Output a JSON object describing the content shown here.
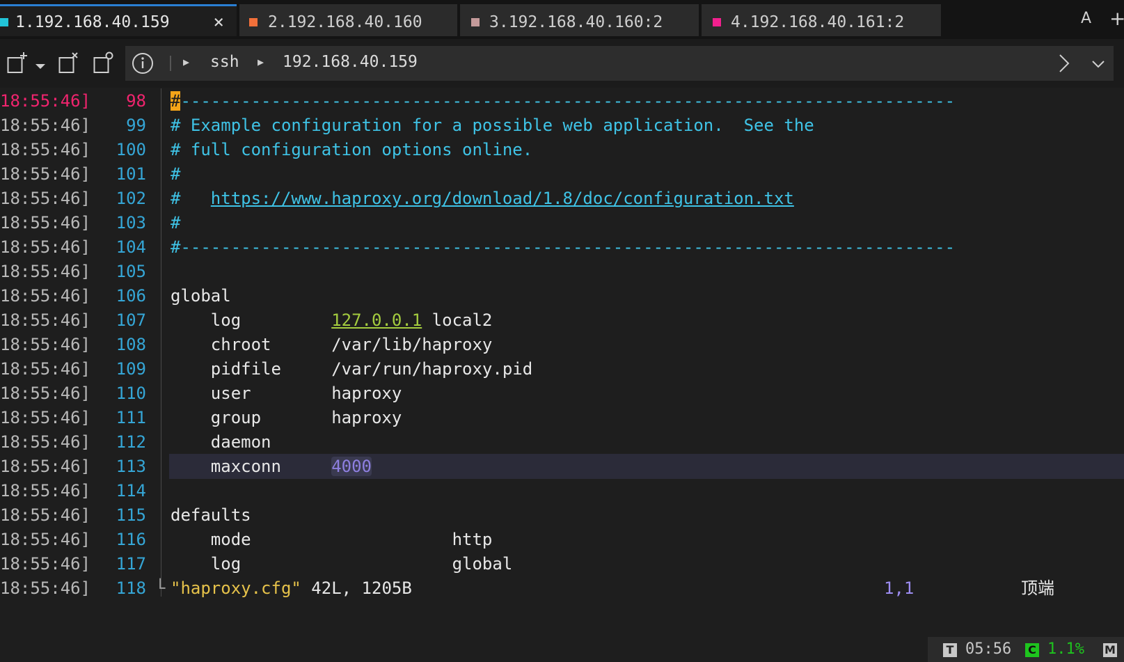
{
  "tabs": [
    {
      "label": "1.192.168.40.159",
      "color": "#22c4d8",
      "active": true
    },
    {
      "label": "2.192.168.40.160",
      "color": "#f2703a",
      "active": false
    },
    {
      "label": "3.192.168.40.160:2",
      "color": "#c49a9a",
      "active": false
    },
    {
      "label": "4.192.168.40.161:2",
      "color": "#f2208e",
      "active": false
    }
  ],
  "tabbar": {
    "close_glyph": "×",
    "font_button": "A",
    "add_tab": "+"
  },
  "toolbar": {
    "icons": [
      "new-tab-icon",
      "dropdown-icon",
      "close-session-icon",
      "session-settings-icon",
      "info-icon",
      "forward-icon",
      "chevron-down-icon"
    ],
    "breadcrumb": [
      "ssh",
      "192.168.40.159"
    ]
  },
  "terminal": {
    "timestamp": "18:55:46]",
    "lines": [
      {
        "n": "98",
        "text": "-----------------------------------------------------------------------------",
        "cursor": "#",
        "kind": "comment"
      },
      {
        "n": "99",
        "text": "# Example configuration for a possible web application.  See the",
        "kind": "comment"
      },
      {
        "n": "100",
        "text": "# full configuration options online.",
        "kind": "comment"
      },
      {
        "n": "101",
        "text": "#",
        "kind": "comment"
      },
      {
        "n": "102",
        "prefix": "#   ",
        "url": "https://www.haproxy.org/download/1.8/doc/configuration.txt",
        "kind": "url"
      },
      {
        "n": "103",
        "text": "#",
        "kind": "comment"
      },
      {
        "n": "104",
        "text": "#-----------------------------------------------------------------------------",
        "kind": "comment"
      },
      {
        "n": "105",
        "text": "",
        "kind": "plain"
      },
      {
        "n": "106",
        "text": "global",
        "kind": "plain"
      },
      {
        "n": "107",
        "key": "    log         ",
        "ip": "127.0.0.1",
        "rest": " local2",
        "kind": "ip"
      },
      {
        "n": "108",
        "text": "    chroot      /var/lib/haproxy",
        "kind": "plain"
      },
      {
        "n": "109",
        "text": "    pidfile     /var/run/haproxy.pid",
        "kind": "plain"
      },
      {
        "n": "110",
        "text": "    user        haproxy",
        "kind": "plain"
      },
      {
        "n": "111",
        "text": "    group       haproxy",
        "kind": "plain"
      },
      {
        "n": "112",
        "text": "    daemon",
        "kind": "plain"
      },
      {
        "n": "113",
        "key": "    maxconn     ",
        "num": "4000",
        "kind": "num",
        "highlight": true
      },
      {
        "n": "114",
        "text": "",
        "kind": "plain"
      },
      {
        "n": "115",
        "text": "defaults",
        "kind": "plain"
      },
      {
        "n": "116",
        "text": "    mode                    http",
        "kind": "plain"
      },
      {
        "n": "117",
        "text": "    log                     global",
        "kind": "plain"
      },
      {
        "n": "118",
        "kind": "status",
        "corner": "└",
        "file": "\"haproxy.cfg\"",
        "info": " 42L, 1205B",
        "position": "1,1",
        "scroll": "顶端"
      }
    ]
  },
  "statusbar": {
    "t_badge": "T",
    "time": "05:56",
    "c_badge": "C",
    "cpu": "1.1%",
    "m_badge": "M"
  }
}
